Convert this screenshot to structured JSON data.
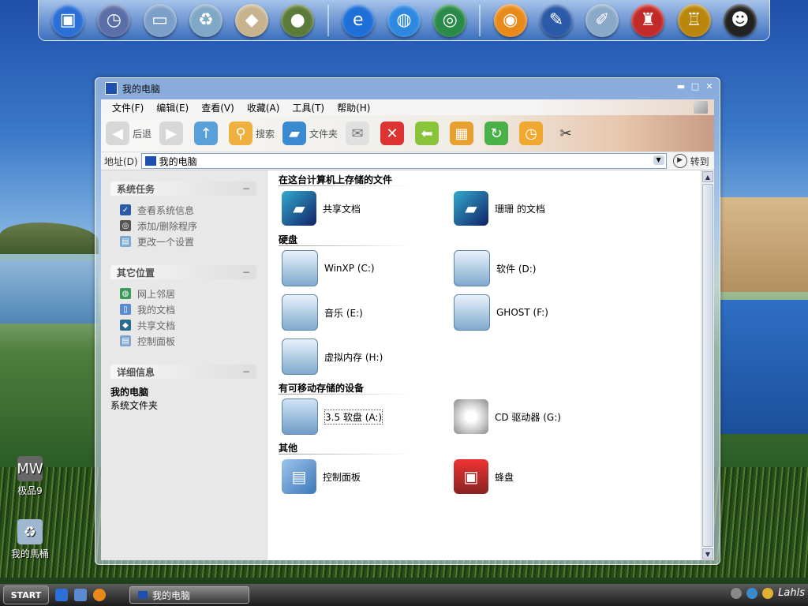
{
  "dock": {
    "icons": [
      {
        "name": "my-computer-icon",
        "glyph": "▣",
        "color": "#2c6fd6"
      },
      {
        "name": "clock-icon",
        "glyph": "◷",
        "color": "#5a6fa8"
      },
      {
        "name": "scanner-icon",
        "glyph": "▭",
        "color": "#7c9fc9"
      },
      {
        "name": "recycle-bin-icon",
        "glyph": "♻",
        "color": "#7fa7c6"
      },
      {
        "name": "qq-box-icon",
        "glyph": "◆",
        "color": "#c8b38f"
      },
      {
        "name": "qq-penguin-group-icon",
        "glyph": "●",
        "color": "#5c7a3a"
      },
      {
        "name": "internet-explorer-icon",
        "glyph": "e",
        "color": "#1f6fd8"
      },
      {
        "name": "globe-icon",
        "glyph": "◍",
        "color": "#2f88e0"
      },
      {
        "name": "network-globe-icon",
        "glyph": "◎",
        "color": "#2a8a4a"
      },
      {
        "name": "media-player-icon",
        "glyph": "◉",
        "color": "#e88a1a"
      },
      {
        "name": "drawing-board-icon",
        "glyph": "✎",
        "color": "#2b5aa8"
      },
      {
        "name": "notepad-tools-icon",
        "glyph": "✐",
        "color": "#8aa8c8"
      },
      {
        "name": "joystick-icon",
        "glyph": "♜",
        "color": "#c22a2a"
      },
      {
        "name": "bronze-vessel-icon",
        "glyph": "♖",
        "color": "#b8860b"
      },
      {
        "name": "qq-penguin-icon",
        "glyph": "☻",
        "color": "#222222"
      }
    ]
  },
  "desktop": {
    "icons": [
      {
        "label": "极品9",
        "glyph": "MW",
        "color": "#555555"
      },
      {
        "label": "我的馬桶",
        "glyph": "♻",
        "color": "#7fa7c6"
      }
    ]
  },
  "window": {
    "title": "我的电脑",
    "menu": [
      "文件(F)",
      "编辑(E)",
      "查看(V)",
      "收藏(A)",
      "工具(T)",
      "帮助(H)"
    ],
    "toolbar": {
      "back": "后退",
      "search": "搜索",
      "folders": "文件夹"
    },
    "address": {
      "label": "地址(D)",
      "value": "我的电脑",
      "go": "转到"
    },
    "sidebar": {
      "tasks": {
        "title": "系统任务",
        "items": [
          "查看系统信息",
          "添加/删除程序",
          "更改一个设置"
        ]
      },
      "places": {
        "title": "其它位置",
        "items": [
          "网上邻居",
          "我的文档",
          "共享文档",
          "控制面板"
        ]
      },
      "details": {
        "title": "详细信息",
        "name": "我的电脑",
        "type": "系统文件夹"
      },
      "collapse": "−"
    },
    "sections": {
      "files": {
        "title": "在这台计算机上存储的文件",
        "items": [
          "共享文档",
          "珊珊 的文档"
        ]
      },
      "drives": {
        "title": "硬盘",
        "items": [
          "WinXP (C:)",
          "软件 (D:)",
          "音乐 (E:)",
          "GHOST (F:)",
          "虚拟内存 (H:)"
        ]
      },
      "removable": {
        "title": "有可移动存储的设备",
        "items": [
          "3.5 软盘 (A:)",
          "CD 驱动器 (G:)"
        ]
      },
      "other": {
        "title": "其他",
        "items": [
          "控制面板",
          "蜂盘"
        ]
      }
    }
  },
  "taskbar": {
    "start": "START",
    "task": "我的电脑",
    "tray_logo": "Lahls"
  }
}
